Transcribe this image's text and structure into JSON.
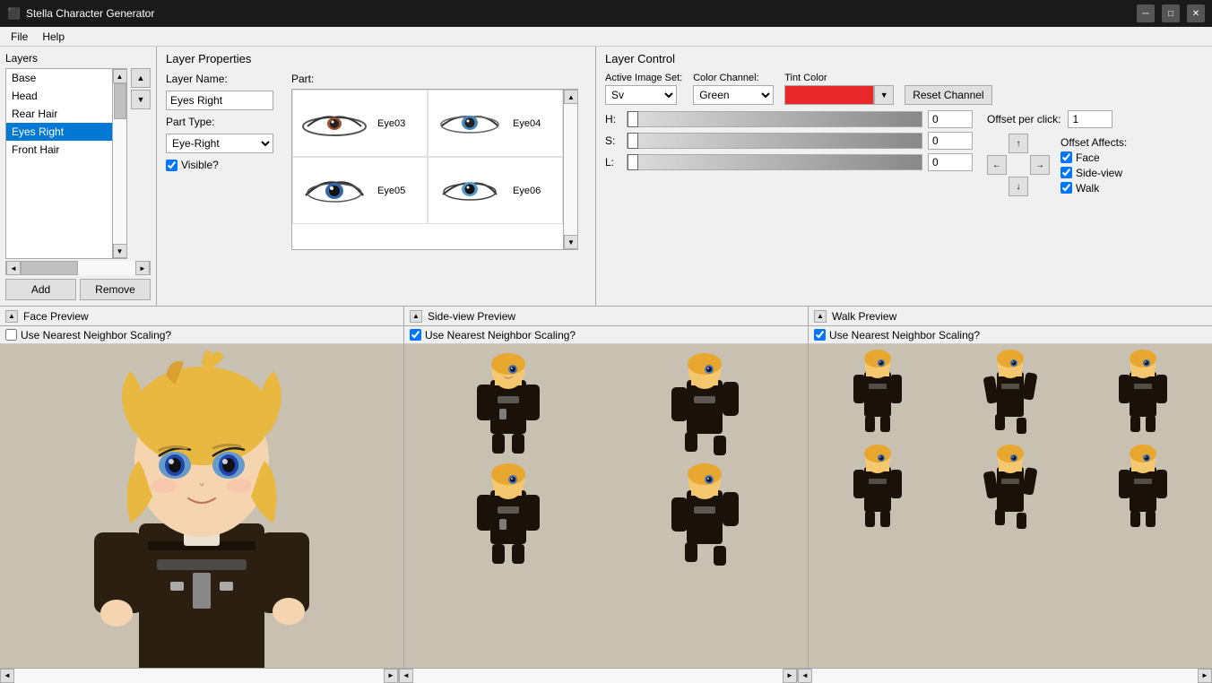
{
  "titlebar": {
    "title": "Stella Character Generator",
    "icon": "★",
    "minimize": "─",
    "maximize": "□",
    "close": "✕"
  },
  "menubar": {
    "items": [
      "File",
      "Help"
    ]
  },
  "layers": {
    "title": "Layers",
    "items": [
      {
        "label": "Base",
        "selected": false
      },
      {
        "label": "Head",
        "selected": false
      },
      {
        "label": "Rear Hair",
        "selected": false
      },
      {
        "label": "Eyes Right",
        "selected": true
      },
      {
        "label": "Front Hair",
        "selected": false
      }
    ],
    "add_label": "Add",
    "remove_label": "Remove"
  },
  "layer_properties": {
    "title": "Layer Properties",
    "layer_name_label": "Layer Name:",
    "layer_name_value": "Eyes Right",
    "part_label": "Part:",
    "part_type_label": "Part Type:",
    "part_type_value": "Eye-Right",
    "visible_label": "Visible?",
    "parts": [
      {
        "id": "Eye03",
        "label": "Eye03"
      },
      {
        "id": "Eye04",
        "label": "Eye04"
      },
      {
        "id": "Eye05",
        "label": "Eye05"
      },
      {
        "id": "Eye06",
        "label": "Eye06"
      }
    ]
  },
  "layer_control": {
    "title": "Layer Control",
    "active_image_set_label": "Active Image Set:",
    "active_image_set_value": "Sv",
    "color_channel_label": "Color Channel:",
    "color_channel_value": "Green",
    "tint_color_label": "Tint Color",
    "reset_channel_label": "Reset Channel",
    "h_label": "H:",
    "h_value": "0",
    "s_label": "S:",
    "s_value": "0",
    "l_label": "L:",
    "l_value": "0",
    "offset_per_click_label": "Offset per click:",
    "offset_value": "1",
    "offset_affects_label": "Offset Affects:",
    "affects": [
      {
        "label": "Face",
        "checked": true
      },
      {
        "label": "Side-view",
        "checked": true
      },
      {
        "label": "Walk",
        "checked": true
      }
    ]
  },
  "face_preview": {
    "title": "Face Preview",
    "nn_label": "Use Nearest Neighbor Scaling?",
    "nn_checked": false
  },
  "side_preview": {
    "title": "Side-view Preview",
    "nn_label": "Use Nearest Neighbor Scaling?",
    "nn_checked": true
  },
  "walk_preview": {
    "title": "Walk Preview",
    "nn_label": "Use Nearest Neighbor Scaling?",
    "nn_checked": true
  },
  "nav_arrows": {
    "up": "↑",
    "left": "←",
    "right": "→",
    "down": "↓"
  }
}
